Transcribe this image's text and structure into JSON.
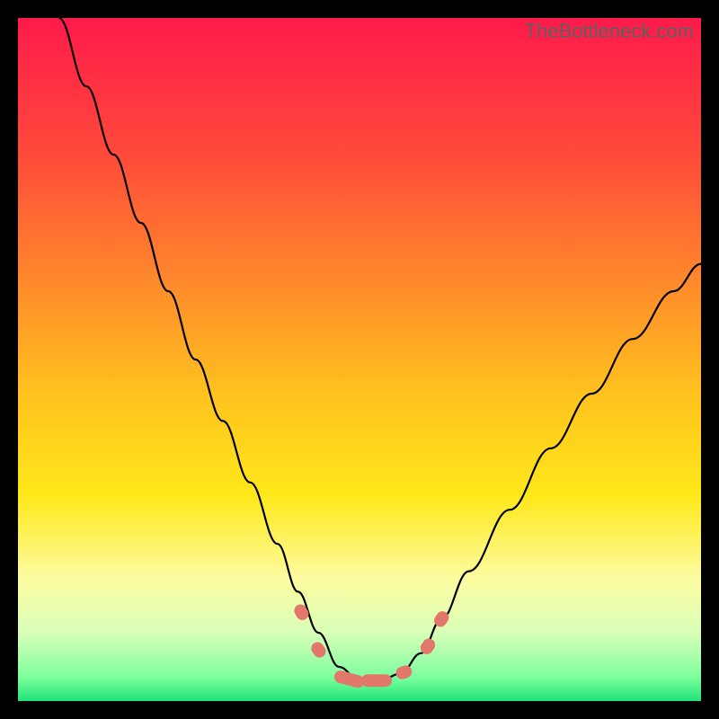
{
  "watermark": "TheBottleneck.com",
  "chart_data": {
    "type": "line",
    "title": "",
    "xlabel": "",
    "ylabel": "",
    "xlim": [
      0,
      100
    ],
    "ylim": [
      0,
      100
    ],
    "grid": false,
    "legend": false,
    "background_gradient": {
      "stops": [
        {
          "offset": 0.0,
          "color": "#ff1a4b"
        },
        {
          "offset": 0.2,
          "color": "#ff4a3a"
        },
        {
          "offset": 0.4,
          "color": "#ff8e2a"
        },
        {
          "offset": 0.55,
          "color": "#ffc21e"
        },
        {
          "offset": 0.7,
          "color": "#ffe81a"
        },
        {
          "offset": 0.82,
          "color": "#fdfca0"
        },
        {
          "offset": 0.9,
          "color": "#d9ffb8"
        },
        {
          "offset": 0.965,
          "color": "#7dff9e"
        },
        {
          "offset": 1.0,
          "color": "#1fe47a"
        }
      ]
    },
    "series": [
      {
        "name": "curve",
        "color": "#000000",
        "x": [
          6,
          10,
          14,
          18,
          22,
          26,
          30,
          34,
          38,
          41,
          44,
          47,
          50,
          53,
          56,
          59,
          62,
          66,
          72,
          78,
          84,
          90,
          96,
          100
        ],
        "y": [
          100,
          90,
          80,
          70,
          60,
          50,
          41,
          32,
          23,
          16,
          10,
          5,
          3,
          3,
          4,
          7,
          12,
          19,
          28,
          37,
          45,
          53,
          60,
          64
        ]
      }
    ],
    "markers": {
      "name": "highlight-dots",
      "color": "#e2786b",
      "shape": "rounded",
      "points": [
        {
          "x": 41.5,
          "y": 13.0,
          "rot": 60
        },
        {
          "x": 44.0,
          "y": 7.5,
          "rot": 55
        },
        {
          "x": 48.5,
          "y": 3.2,
          "rot": 15
        },
        {
          "x": 52.5,
          "y": 3.0,
          "rot": 0
        },
        {
          "x": 56.5,
          "y": 4.2,
          "rot": -20
        },
        {
          "x": 60.0,
          "y": 8.0,
          "rot": -55
        },
        {
          "x": 62.0,
          "y": 12.0,
          "rot": -55
        }
      ]
    }
  }
}
